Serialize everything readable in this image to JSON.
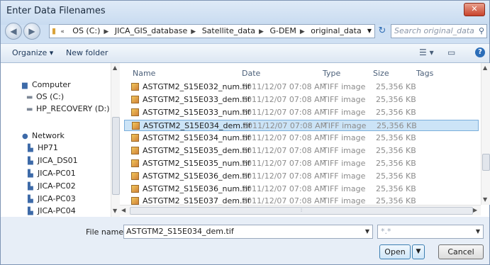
{
  "window": {
    "title": "Enter Data Filenames",
    "close_label": "✕"
  },
  "address": {
    "segments": [
      "OS (C:)",
      "JICA_GIS_database",
      "Satellite_data",
      "G-DEM",
      "original_data"
    ],
    "search_placeholder": "Search original_data"
  },
  "toolbar": {
    "organize_label": "Organize ▾",
    "new_folder_label": "New folder"
  },
  "nav": {
    "items": [
      {
        "label": "Computer",
        "icon": "computer-icon"
      },
      {
        "label": "OS (C:)",
        "icon": "drive-icon"
      },
      {
        "label": "HP_RECOVERY (D:)",
        "icon": "drive-icon"
      },
      {
        "label": "Network",
        "icon": "network-icon"
      },
      {
        "label": "HP71",
        "icon": "pc-icon"
      },
      {
        "label": "JICA_DS01",
        "icon": "pc-icon"
      },
      {
        "label": "JICA-PC01",
        "icon": "pc-icon"
      },
      {
        "label": "JICA-PC02",
        "icon": "pc-icon"
      },
      {
        "label": "JICA-PC03",
        "icon": "pc-icon"
      },
      {
        "label": "JICA-PC04",
        "icon": "pc-icon"
      }
    ]
  },
  "files": {
    "columns": [
      "Name",
      "Date",
      "Type",
      "Size",
      "Tags"
    ],
    "rows": [
      {
        "name": "ASTGTM2_S15E032_num.tif",
        "date": "2011/12/07 07:08 AM",
        "type": "TIFF image",
        "size": "25,356 KB"
      },
      {
        "name": "ASTGTM2_S15E033_dem.tif",
        "date": "2011/12/07 07:08 AM",
        "type": "TIFF image",
        "size": "25,356 KB"
      },
      {
        "name": "ASTGTM2_S15E033_num.tif",
        "date": "2011/12/07 07:08 AM",
        "type": "TIFF image",
        "size": "25,356 KB"
      },
      {
        "name": "ASTGTM2_S15E034_dem.tif",
        "date": "2011/12/07 07:08 AM",
        "type": "TIFF image",
        "size": "25,356 KB",
        "selected": true
      },
      {
        "name": "ASTGTM2_S15E034_num.tif",
        "date": "2011/12/07 07:08 AM",
        "type": "TIFF image",
        "size": "25,356 KB"
      },
      {
        "name": "ASTGTM2_S15E035_dem.tif",
        "date": "2011/12/07 07:08 AM",
        "type": "TIFF image",
        "size": "25,356 KB"
      },
      {
        "name": "ASTGTM2_S15E035_num.tif",
        "date": "2011/12/07 07:08 AM",
        "type": "TIFF image",
        "size": "25,356 KB"
      },
      {
        "name": "ASTGTM2_S15E036_dem.tif",
        "date": "2011/12/07 07:08 AM",
        "type": "TIFF image",
        "size": "25,356 KB"
      },
      {
        "name": "ASTGTM2_S15E036_num.tif",
        "date": "2011/12/07 07:08 AM",
        "type": "TIFF image",
        "size": "25,356 KB"
      },
      {
        "name": "ASTGTM2_S15E037_dem.tif",
        "date": "2011/12/07 07:08 AM",
        "type": "TIFF image",
        "size": "25,356 KB"
      }
    ]
  },
  "footer": {
    "filename_label": "File name:",
    "filename_value": "ASTGTM2_S15E034_dem.tif",
    "filetype_value": "*.*",
    "open_label": "Open",
    "cancel_label": "Cancel"
  }
}
